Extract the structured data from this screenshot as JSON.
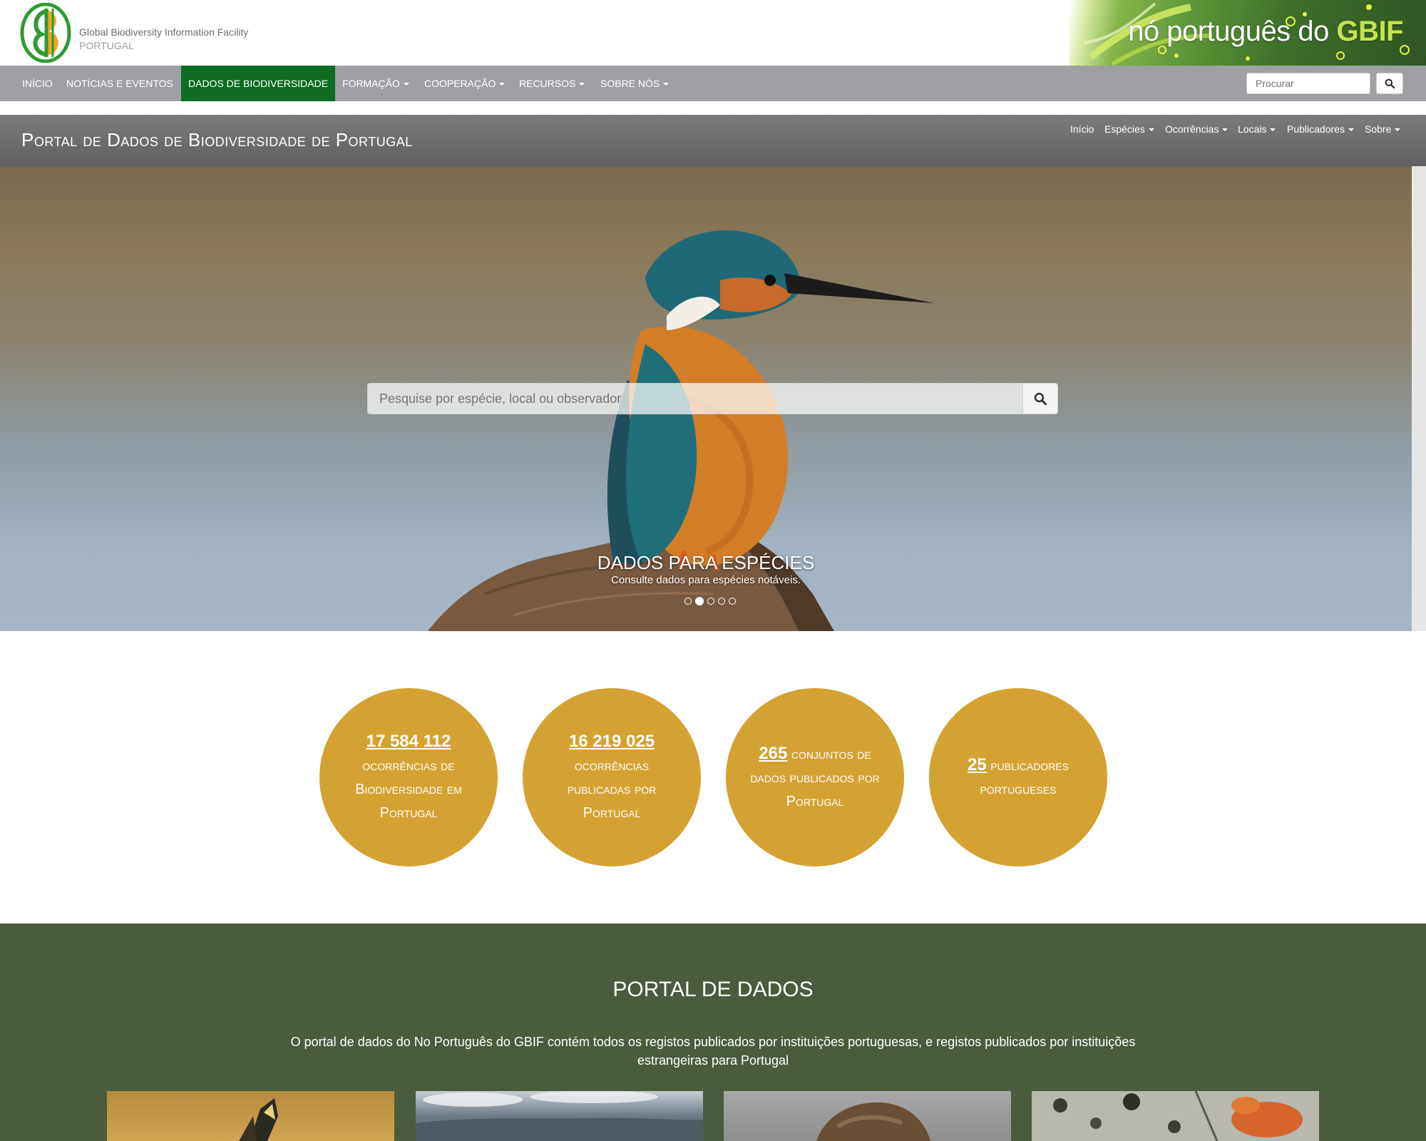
{
  "brand": {
    "name": "Global Biodiversity Information Facility",
    "country": "PORTUGAL",
    "banner_text": "nó português do",
    "banner_gbif": "GBIF"
  },
  "main_nav": {
    "items": [
      {
        "label": "INÍCIO"
      },
      {
        "label": "NOTÍCIAS E EVENTOS"
      },
      {
        "label": "DADOS DE BIODIVERSIDADE"
      },
      {
        "label": "FORMAÇÃO"
      },
      {
        "label": "COOPERAÇÃO"
      },
      {
        "label": "RECURSOS"
      },
      {
        "label": "SOBRE NÓS"
      }
    ],
    "search_placeholder": "Procurar"
  },
  "portal_bar": {
    "title": "Portal de Dados de Biodiversidade de Portugal",
    "items": [
      {
        "label": "Início"
      },
      {
        "label": "Espécies"
      },
      {
        "label": "Ocorrências"
      },
      {
        "label": "Locais"
      },
      {
        "label": "Publicadores"
      },
      {
        "label": "Sobre"
      }
    ]
  },
  "hero": {
    "search_placeholder": "Pesquise por espécie, local ou observador",
    "caption_title": "DADOS PARA ESPÉCIES",
    "caption_subtitle": "Consulte dados para espécies notáveis.",
    "slide_count": 5,
    "active_slide": 2
  },
  "stats": [
    {
      "number": "17 584 112",
      "text": "ocorrências de Biodiversidade em Portugal"
    },
    {
      "number": "16 219 025",
      "text": "ocorrências publicadas por Portugal"
    },
    {
      "number": "265",
      "text": "conjuntos de dados publicados por Portugal"
    },
    {
      "number": "25",
      "text": "publicadores portugueses"
    }
  ],
  "portal_section": {
    "title": "PORTAL DE DADOS",
    "description": "O portal de dados do No Português do GBIF contém todos os registos publicados por instituições portuguesas, e registos publicados por instituições estrangeiras para Portugal"
  },
  "colors": {
    "nav_bg": "#9ea0a3",
    "nav_active": "#0f6d21",
    "stat_circle": "#d4a232",
    "section_bg": "#4b5b3e"
  }
}
